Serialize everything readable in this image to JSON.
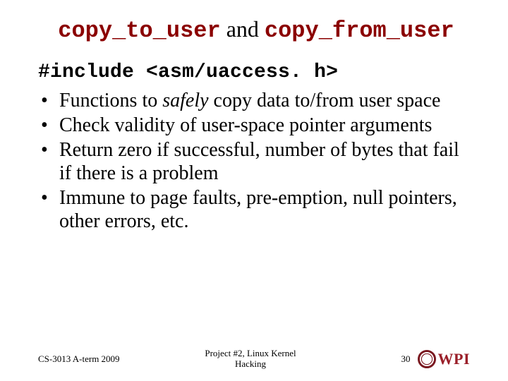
{
  "title": {
    "fn1": "copy_to_user",
    "and": " and ",
    "fn2": "copy_from_user"
  },
  "include_line": "#include <asm/uaccess. h>",
  "bullets": [
    {
      "pre": "Functions to ",
      "em": "safely",
      "post": " copy data to/from user space"
    },
    {
      "pre": "Check validity of user-space pointer arguments",
      "em": "",
      "post": ""
    },
    {
      "pre": "Return zero if successful, number of bytes that fail if there is a problem",
      "em": "",
      "post": ""
    },
    {
      "pre": "Immune to page faults, pre-emption, null pointers, other errors, etc.",
      "em": "",
      "post": ""
    }
  ],
  "footer": {
    "left": "CS-3013 A-term 2009",
    "center_line1": "Project #2, Linux Kernel",
    "center_line2": "Hacking",
    "page": "30",
    "logo_text": "WPI"
  }
}
